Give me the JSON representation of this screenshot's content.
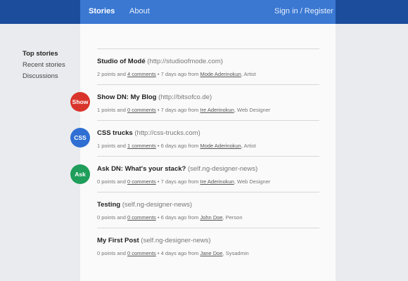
{
  "nav": {
    "stories": "Stories",
    "about": "About",
    "signin": "Sign in / Register"
  },
  "sidebar": {
    "items": [
      {
        "label": "Top stories"
      },
      {
        "label": "Recent stories"
      },
      {
        "label": "Discussions"
      }
    ]
  },
  "stories": [
    {
      "title": "Studio of Modé",
      "domain": "(http://studioofmode.com)",
      "points": "2 points and ",
      "comments": "4 comments",
      "age": " • 7 days ago from ",
      "author": "Mode Aderinokun",
      "role": ", Artist"
    },
    {
      "title": "Show DN: My Blog",
      "domain": "(http://bitsofco.de)",
      "points": "1 points and ",
      "comments": "0 comments",
      "age": " • 7 days ago from ",
      "author": "Ire Aderinokun",
      "role": ", Web Designer",
      "badge": {
        "label": "Show",
        "color": "#d9342b"
      }
    },
    {
      "title": "CSS trucks",
      "domain": "(http://css-trucks.com)",
      "points": "1 points and ",
      "comments": "1 comments",
      "age": " • 6 days ago from ",
      "author": "Mode Aderinokun",
      "role": ", Artist",
      "badge": {
        "label": "CSS",
        "color": "#2f6fd3"
      }
    },
    {
      "title": "Ask DN: What's your stack?",
      "domain": "(self.ng-designer-news)",
      "points": "0 points and ",
      "comments": "0 comments",
      "age": " • 7 days ago from ",
      "author": "Ire Aderinokun",
      "role": ", Web Designer",
      "badge": {
        "label": "Ask",
        "color": "#1e9e5a"
      }
    },
    {
      "title": "Testing",
      "domain": "(self.ng-designer-news)",
      "points": "0 points and ",
      "comments": "0 comments",
      "age": " • 6 days ago from ",
      "author": "John Doe",
      "role": ", Person"
    },
    {
      "title": "My First Post",
      "domain": "(self.ng-designer-news)",
      "points": "0 points and ",
      "comments": "0 comments",
      "age": " • 4 days ago from ",
      "author": "Jane Doe",
      "role": ", Sysadmin"
    }
  ]
}
